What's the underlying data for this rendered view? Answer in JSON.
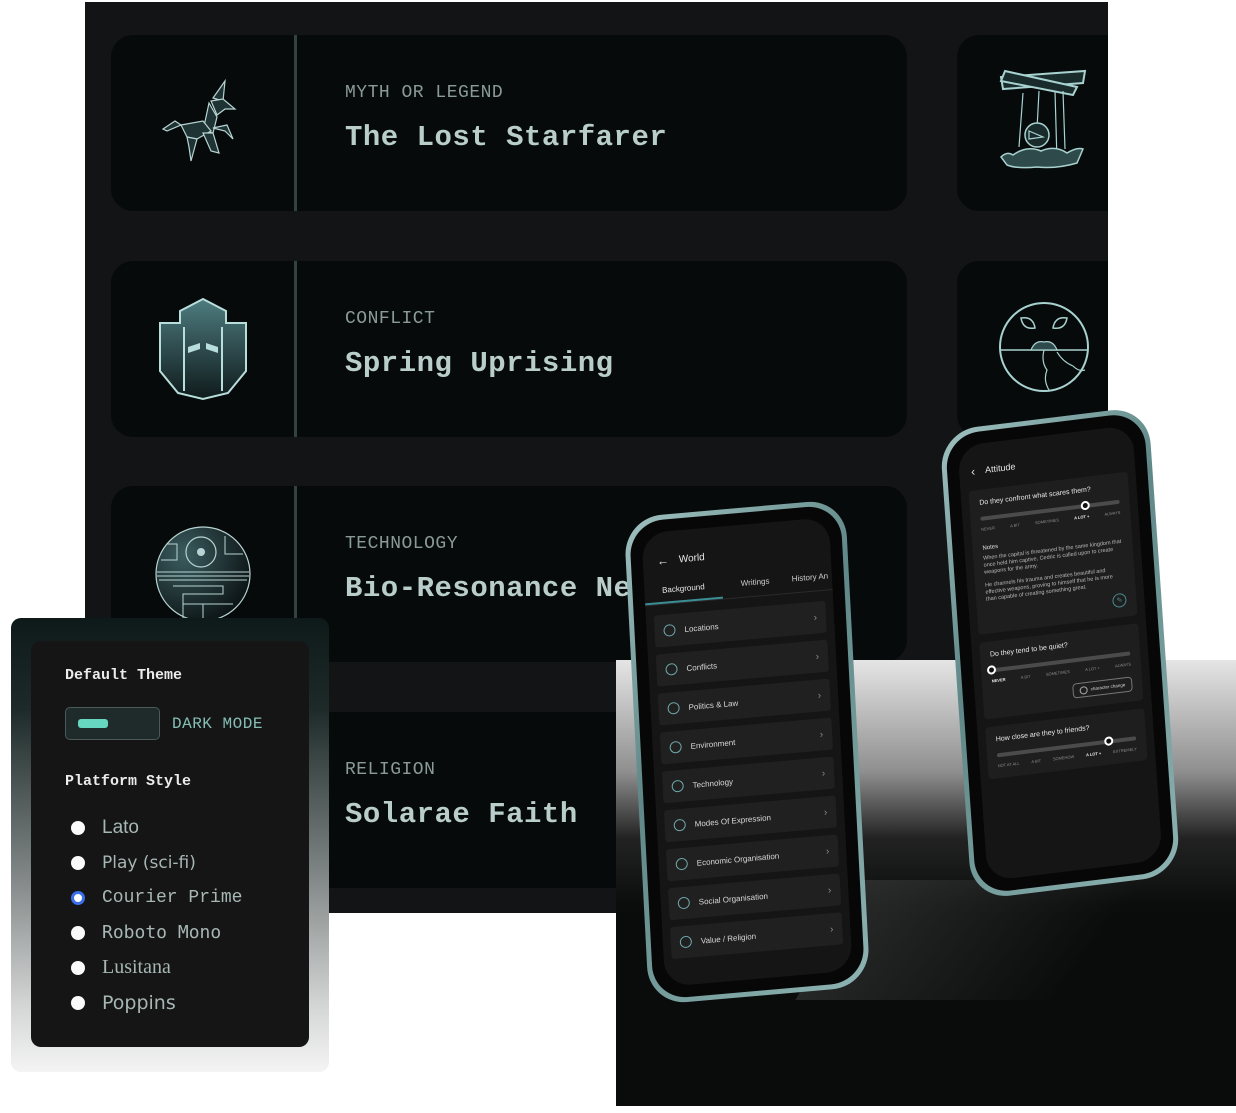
{
  "cards": [
    {
      "category": "MYTH OR LEGEND",
      "title": "The Lost Starfarer",
      "icon": "origami-unicorn-icon"
    },
    {
      "category": "CONFLICT",
      "title": "Spring Uprising",
      "icon": "shield-icon"
    },
    {
      "category": "TECHNOLOGY",
      "title": "Bio-Resonance Ne",
      "icon": "circuit-sphere-icon"
    },
    {
      "category": "RELIGION",
      "title": "Solarae Faith",
      "icon": "religion-icon"
    }
  ],
  "side_cards": [
    {
      "icon": "puppet-marionette-icon"
    },
    {
      "icon": "earth-sprout-icon"
    }
  ],
  "settings": {
    "default_theme_label": "Default Theme",
    "dark_mode_label": "DARK MODE",
    "dark_mode_on": true,
    "platform_style_label": "Platform Style",
    "options": [
      "Lato",
      "Play (sci-fi)",
      "Courier Prime",
      "Roboto Mono",
      "Lusitana",
      "Poppins"
    ],
    "selected": "Courier Prime",
    "accent_color": "#66d6c1",
    "radio_selected_color": "#3a6fe8"
  },
  "world_phone": {
    "back_icon": "arrow-left-icon",
    "title": "World",
    "tabs": [
      "Background",
      "Writings",
      "History An"
    ],
    "active_tab": "Background",
    "items": [
      {
        "label": "Locations",
        "icon": "pillars-icon"
      },
      {
        "label": "Conflicts",
        "icon": "helmet-icon"
      },
      {
        "label": "Politics & Law",
        "icon": "person-pin-icon"
      },
      {
        "label": "Environment",
        "icon": "globe-leaf-icon"
      },
      {
        "label": "Technology",
        "icon": "gear-target-icon"
      },
      {
        "label": "Modes Of Expression",
        "icon": "mask-icon"
      },
      {
        "label": "Economic Organisation",
        "icon": "ring-icon"
      },
      {
        "label": "Social Organisation",
        "icon": "network-icon"
      },
      {
        "label": "Value / Religion",
        "icon": "sun-icon"
      }
    ]
  },
  "attitude_phone": {
    "back_icon": "chevron-left-icon",
    "title": "Attitude",
    "q1": {
      "question": "Do they confront what scares them?",
      "labels": [
        "NEVER",
        "A BIT",
        "SOMETIMES",
        "A LOT +",
        "ALWAYS"
      ],
      "selected": "A LOT +",
      "value": 0.75
    },
    "notes_label": "Notes",
    "notes": [
      "When the capital is threatened by the same kingdom that once held him captive, Cedric is called upon to create weapons for the army.",
      "He channels his trauma and creates beautiful and effective weapons, proving to himself that he is more than capable of creating something great."
    ],
    "q2": {
      "question": "Do they tend to be quiet?",
      "labels": [
        "NEVER",
        "A BIT",
        "SOMETIMES",
        "A LOT +",
        "ALWAYS"
      ],
      "selected": "NEVER",
      "value": 0.0
    },
    "character_change_label": "character change",
    "q3": {
      "question": "How close are they to friends?",
      "labels": [
        "NOT AT ALL",
        "A BIT",
        "SOMEHOW",
        "A LOT +",
        "EXTREMELY"
      ],
      "selected": "A LOT +",
      "value": 0.8
    }
  }
}
